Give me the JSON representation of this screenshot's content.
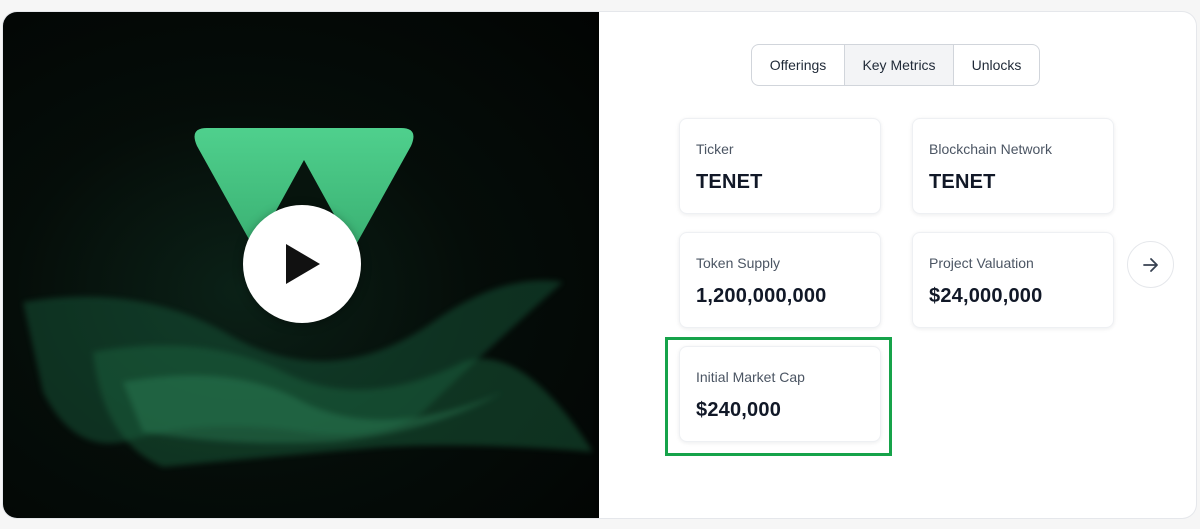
{
  "media": {
    "logo_icon": "triangle-logo-icon",
    "play_icon": "play-icon",
    "accent": "#45c983"
  },
  "tabs": [
    {
      "label": "Offerings",
      "active": false
    },
    {
      "label": "Key Metrics",
      "active": true
    },
    {
      "label": "Unlocks",
      "active": false
    }
  ],
  "metrics": [
    {
      "label": "Ticker",
      "value": "TENET"
    },
    {
      "label": "Blockchain Network",
      "value": "TENET"
    },
    {
      "label": "Token Supply",
      "value": "1,200,000,000"
    },
    {
      "label": "Project Valuation",
      "value": "$24,000,000"
    },
    {
      "label": "Initial Market Cap",
      "value": "$240,000",
      "highlighted": true
    }
  ],
  "highlight_color": "#16a34a",
  "next_icon": "arrow-right-icon"
}
